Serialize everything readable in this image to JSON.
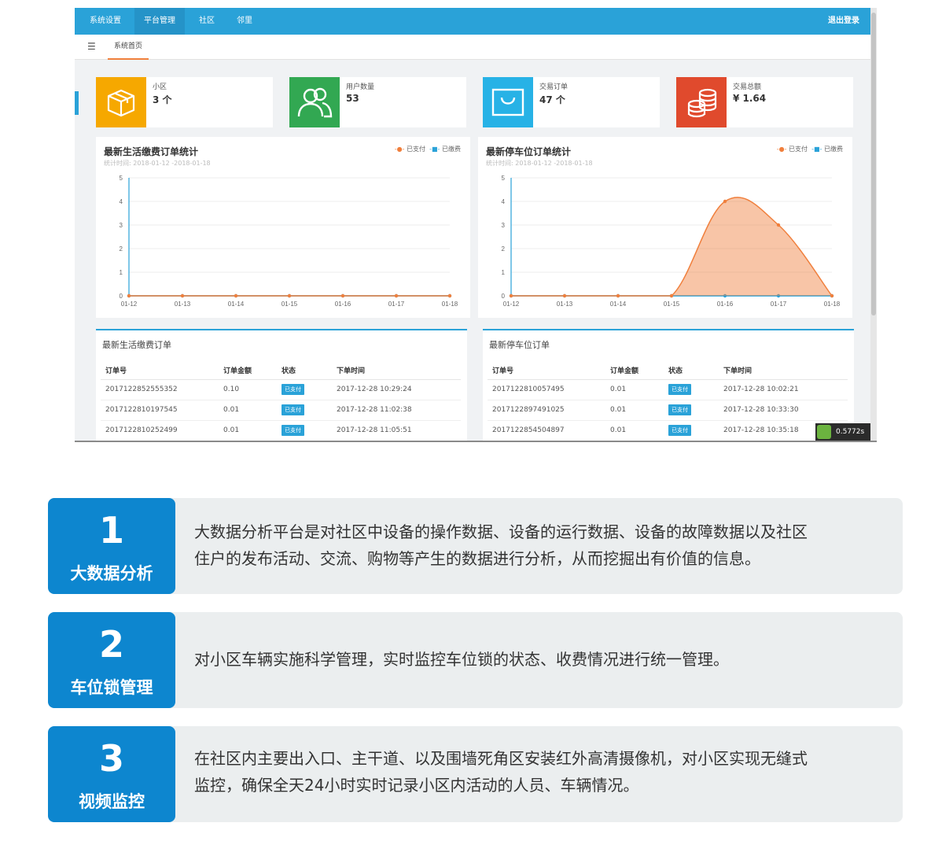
{
  "topnav": {
    "items": [
      "系统设置",
      "平台管理",
      "社区",
      "邻里"
    ],
    "active_index": 1,
    "logout": "退出登录"
  },
  "tabs": {
    "home": "系统首页"
  },
  "stats": [
    {
      "label": "小区",
      "value": "3 个",
      "color": "#f6a800",
      "icon": "box-icon"
    },
    {
      "label": "用户数量",
      "value": "53",
      "color": "#32a852",
      "icon": "users-icon"
    },
    {
      "label": "交易订单",
      "value": "47 个",
      "color": "#27b2e6",
      "icon": "shopping-bag-icon"
    },
    {
      "label": "交易总额",
      "value": "¥ 1.64",
      "color": "#e04a2d",
      "icon": "coins-icon"
    }
  ],
  "legend": {
    "paid": "已支付",
    "unpaid": "已缴费"
  },
  "charts": [
    {
      "title": "最新生活缴费订单统计",
      "subtitle": "统计时间: 2018-01-12 -2018-01-18",
      "chart_data": {
        "type": "area",
        "categories": [
          "01-12",
          "01-13",
          "01-14",
          "01-15",
          "01-16",
          "01-17",
          "01-18"
        ],
        "series": [
          {
            "name": "已支付",
            "values": [
              0,
              0,
              0,
              0,
              0,
              0,
              0
            ],
            "color": "#f07f3c"
          },
          {
            "name": "已缴费",
            "values": [
              0,
              0,
              0,
              0,
              0,
              0,
              0
            ],
            "color": "#2aa2d8"
          }
        ],
        "yticks": [
          "0",
          "1",
          "2",
          "3",
          "4",
          "5"
        ],
        "ylim": [
          0,
          5
        ],
        "grid": true,
        "legend_position": "top-right"
      }
    },
    {
      "title": "最新停车位订单统计",
      "subtitle": "统计时间: 2018-01-12 -2018-01-18",
      "chart_data": {
        "type": "area",
        "categories": [
          "01-12",
          "01-13",
          "01-14",
          "01-15",
          "01-16",
          "01-17",
          "01-18"
        ],
        "series": [
          {
            "name": "已支付",
            "values": [
              0,
              0,
              0,
              0,
              4,
              3,
              0
            ],
            "color": "#f07f3c"
          },
          {
            "name": "已缴费",
            "values": [
              0,
              0,
              0,
              0,
              0,
              0,
              0
            ],
            "color": "#2aa2d8"
          }
        ],
        "yticks": [
          "0",
          "1",
          "2",
          "3",
          "4",
          "5"
        ],
        "ylim": [
          0,
          5
        ],
        "grid": true,
        "legend_position": "top-right"
      }
    }
  ],
  "tables": [
    {
      "title": "最新生活缴费订单",
      "columns": [
        "订单号",
        "订单金额",
        "状态",
        "下单时间"
      ],
      "rows": [
        [
          "2017122852555352",
          "0.10",
          "已支付",
          "2017-12-28 10:29:24"
        ],
        [
          "2017122810197545",
          "0.01",
          "已支付",
          "2017-12-28 11:02:38"
        ],
        [
          "2017122810252499",
          "0.01",
          "已支付",
          "2017-12-28 11:05:51"
        ]
      ]
    },
    {
      "title": "最新停车位订单",
      "columns": [
        "订单号",
        "订单金额",
        "状态",
        "下单时间"
      ],
      "rows": [
        [
          "2017122810057495",
          "0.01",
          "已支付",
          "2017-12-28 10:02:21"
        ],
        [
          "2017122897491025",
          "0.01",
          "已支付",
          "2017-12-28 10:33:30"
        ],
        [
          "2017122854504897",
          "0.01",
          "已支付",
          "2017-12-28 10:35:18"
        ]
      ]
    }
  ],
  "timer": "0.5772s",
  "features": [
    {
      "number": "1",
      "title": "大数据分析",
      "desc_lines": [
        "大数据分析平台是对社区中设备的操作数据、设备的运行数据、设备的故障数据以及社区",
        "住户的发布活动、交流、购物等产生的数据进行分析，从而挖掘出有价值的信息。"
      ]
    },
    {
      "number": "2",
      "title": "车位锁管理",
      "desc_lines": [
        "对小区车辆实施科学管理，实时监控车位锁的状态、收费情况进行统一管理。"
      ]
    },
    {
      "number": "3",
      "title": "视频监控",
      "desc_lines": [
        "在社区内主要出入口、主干道、以及围墙死角区安装红外高清摄像机，对小区实现无缝式",
        "监控，确保全天24小时实时记录小区内活动的人员、车辆情况。"
      ]
    }
  ]
}
